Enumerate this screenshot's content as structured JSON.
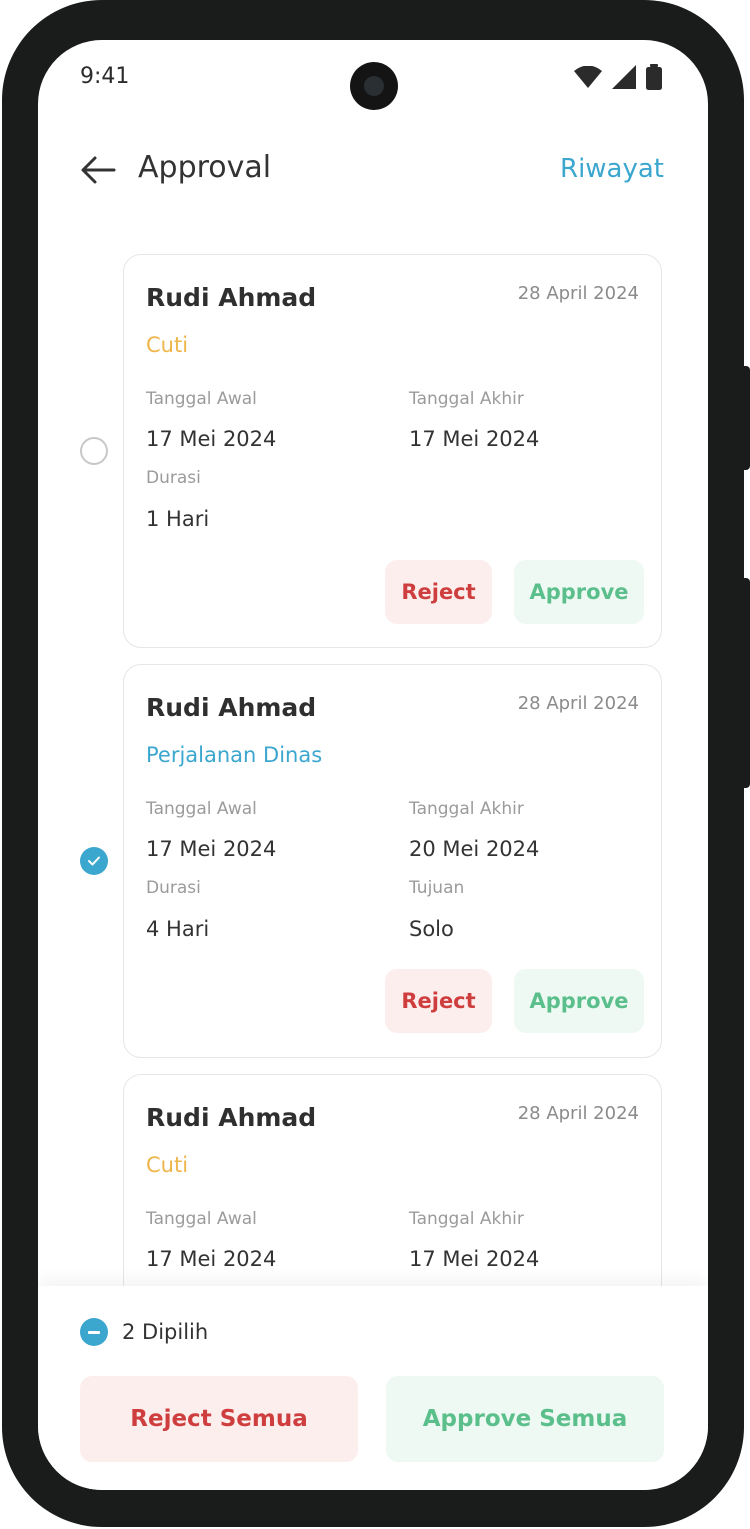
{
  "status_bar": {
    "time": "9:41"
  },
  "header": {
    "title": "Approval",
    "history_label": "Riwayat"
  },
  "labels": {
    "start_date": "Tanggal Awal",
    "end_date": "Tanggal Akhir",
    "duration": "Durasi",
    "destination": "Tujuan",
    "reject": "Reject",
    "approve": "Approve"
  },
  "requests": [
    {
      "name": "Rudi Ahmad",
      "date": "28 April 2024",
      "type": "Cuti",
      "start": "17 Mei 2024",
      "end": "17 Mei 2024",
      "duration": "1 Hari",
      "selected": false
    },
    {
      "name": "Rudi Ahmad",
      "date": "28 April 2024",
      "type": "Perjalanan Dinas",
      "start": "17 Mei 2024",
      "end": "20 Mei 2024",
      "duration": "4 Hari",
      "destination": "Solo",
      "selected": true
    },
    {
      "name": "Rudi Ahmad",
      "date": "28 April 2024",
      "type": "Cuti",
      "start": "17 Mei 2024",
      "end": "17 Mei 2024",
      "selected": true
    }
  ],
  "bottom_bar": {
    "selected_text": "2 Dipilih",
    "reject_all": "Reject Semua",
    "approve_all": "Approve Semua"
  },
  "colors": {
    "accent": "#3ba7cf",
    "cuti": "#eeb54a",
    "dinas": "#3ba7cf",
    "reject_text": "#cf3e3e",
    "reject_bg": "#fdeeee",
    "approve_text": "#5bbf8c",
    "approve_bg": "#edf9f2"
  }
}
